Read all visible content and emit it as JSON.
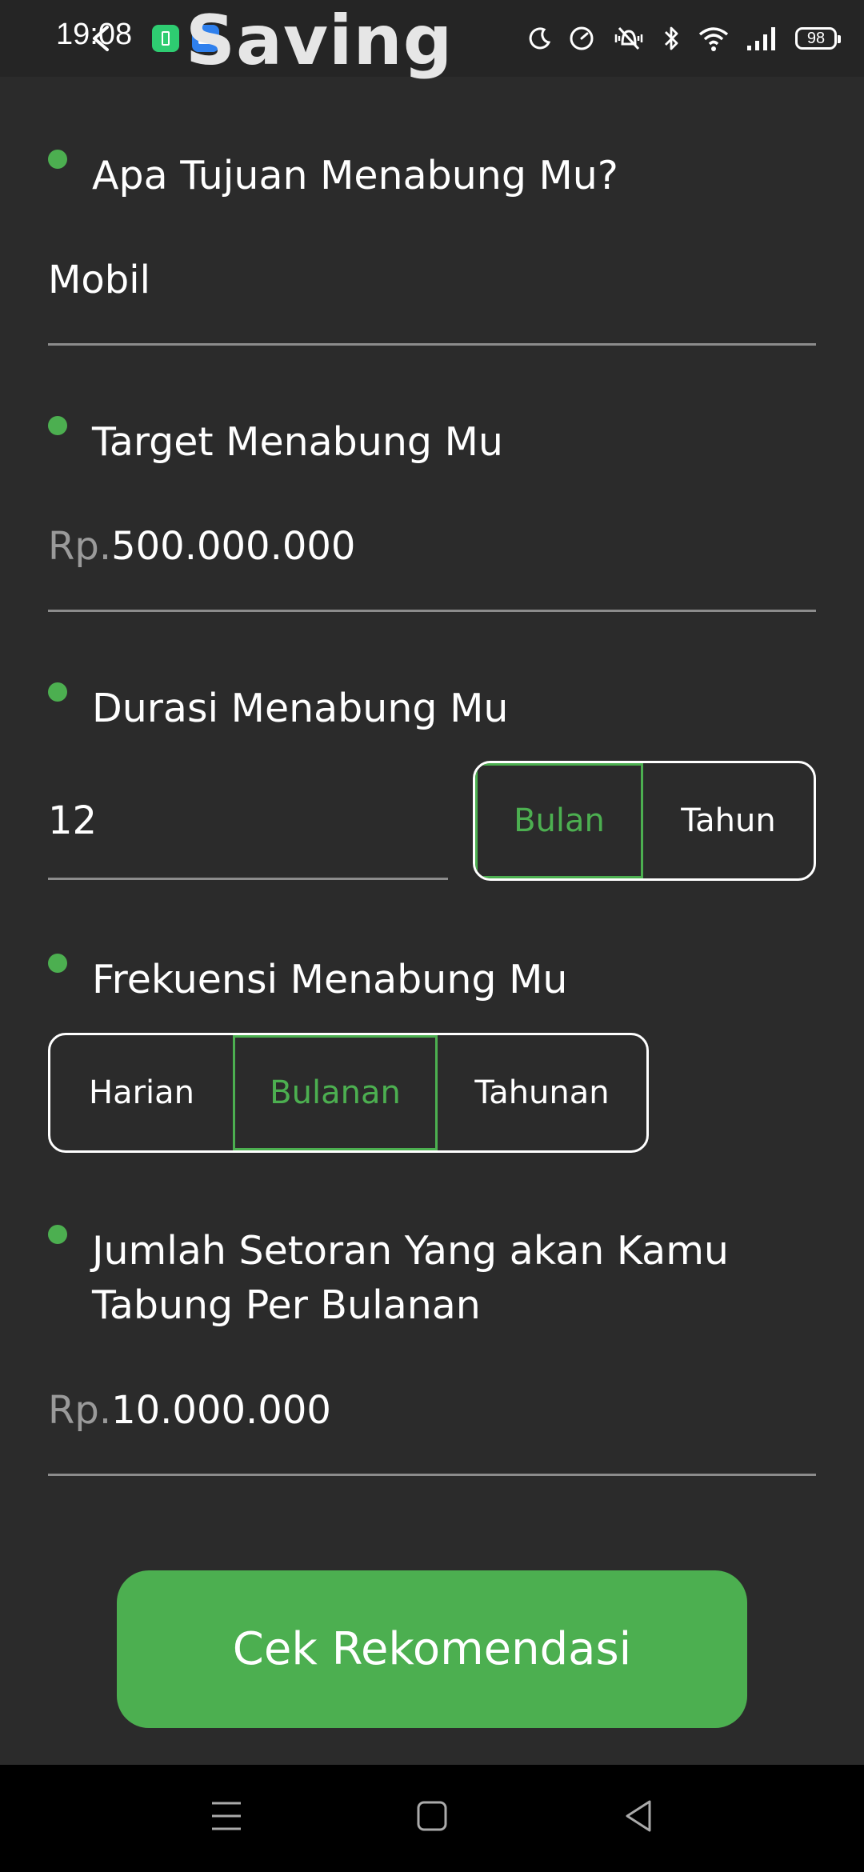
{
  "status_bar": {
    "time": "19:08",
    "battery_level": "98",
    "icons": [
      "battery-saver-app-icon",
      "android-app-icon",
      "moon-icon",
      "speedometer-icon",
      "vibrate-off-icon",
      "bluetooth-icon",
      "wifi-icon",
      "signal-icon",
      "battery-icon"
    ]
  },
  "header": {
    "title": "Saving",
    "back_icon": "back-arrow-icon"
  },
  "form": {
    "goal": {
      "label": "Apa Tujuan Menabung Mu?",
      "value": "Mobil"
    },
    "target": {
      "label": "Target Menabung Mu",
      "prefix": "Rp.",
      "value": "500.000.000"
    },
    "duration": {
      "label": "Durasi Menabung Mu",
      "value": "12",
      "options": [
        "Bulan",
        "Tahun"
      ],
      "selected": "Bulan"
    },
    "frequency": {
      "label": "Frekuensi Menabung Mu",
      "options": [
        "Harian",
        "Bulanan",
        "Tahunan"
      ],
      "selected": "Bulanan"
    },
    "deposit": {
      "label_line1": "Jumlah Setoran Yang akan Kamu",
      "label_line2": "Tabung Per Bulanan",
      "prefix": "Rp.",
      "value": "10.000.000"
    }
  },
  "cta": {
    "label": "Cek Rekomendasi"
  },
  "nav_bar": {
    "icons": [
      "menu-icon",
      "home-icon",
      "back-icon"
    ]
  },
  "colors": {
    "background": "#2b2b2b",
    "accent": "#4caf50",
    "text": "#ffffff",
    "muted": "#9a9a9a"
  }
}
